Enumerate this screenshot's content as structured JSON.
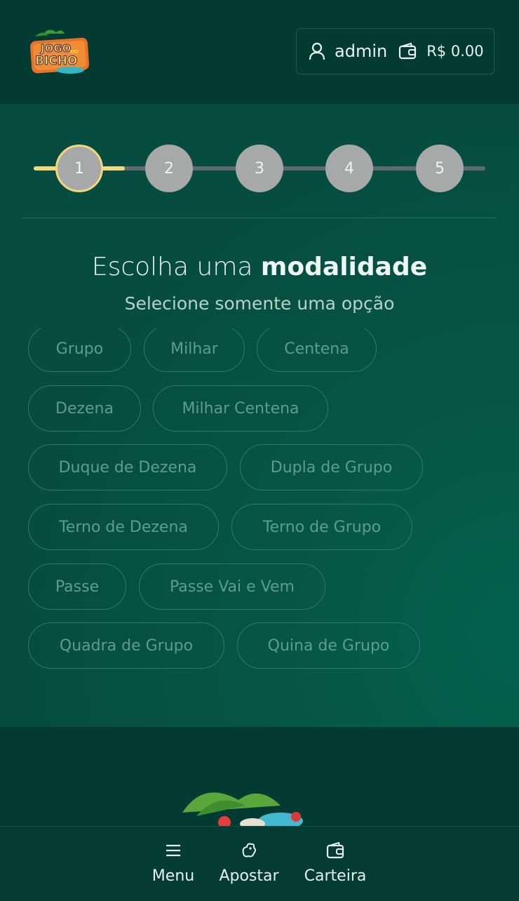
{
  "header": {
    "logo_text_top": "JOGO",
    "logo_text_mid": "DO",
    "logo_text_bottom": "BICHO",
    "username": "admin",
    "balance": "R$ 0.00"
  },
  "stepper": {
    "steps": [
      "1",
      "2",
      "3",
      "4",
      "5"
    ],
    "active_step": 1
  },
  "section": {
    "title_light": "Escolha uma ",
    "title_bold": "modalidade",
    "subtitle": "Selecione somente uma opção"
  },
  "options": [
    "Grupo",
    "Milhar",
    "Centena",
    "Dezena",
    "Milhar Centena",
    "Duque de Dezena",
    "Dupla de Grupo",
    "Terno de Dezena",
    "Terno de Grupo",
    "Passe",
    "Passe Vai e Vem",
    "Quadra de Grupo",
    "Quina de Grupo"
  ],
  "bottom_nav": {
    "menu": "Menu",
    "bet": "Apostar",
    "wallet": "Carteira"
  },
  "colors": {
    "accent": "#f4d77a",
    "background": "#033a31",
    "panel": "#064c40"
  }
}
